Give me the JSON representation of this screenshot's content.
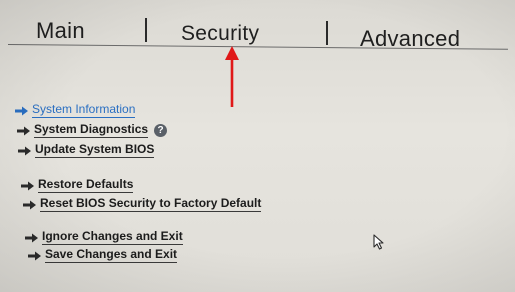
{
  "tabs": [
    {
      "label": "Main"
    },
    {
      "label": "Security"
    },
    {
      "label": "Advanced"
    }
  ],
  "menu": {
    "items": [
      {
        "label": "System Information",
        "state": "selected"
      },
      {
        "label": "System Diagnostics",
        "help_icon": "?"
      },
      {
        "label": "Update System BIOS"
      },
      {
        "label": "Restore Defaults"
      },
      {
        "label": "Reset BIOS Security to Factory Default"
      },
      {
        "label": "Ignore Changes and Exit"
      },
      {
        "label": "Save Changes and Exit"
      }
    ]
  },
  "icons": {
    "item_arrow": "right-arrow-icon",
    "help": "help-icon",
    "cursor": "mouse-pointer-icon",
    "annotation": "red-up-arrow"
  },
  "colors": {
    "selected_item": "#2a6fc2",
    "item_text": "#1c1c1c",
    "annotation_arrow": "#e01818",
    "background": "#e2e0da"
  }
}
